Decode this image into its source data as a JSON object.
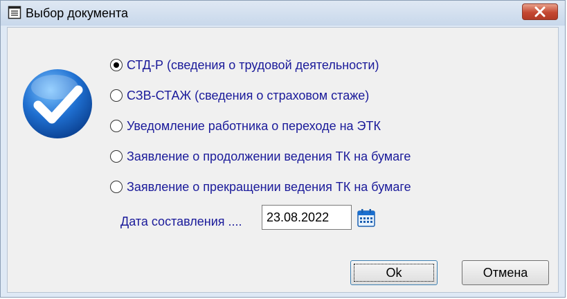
{
  "window": {
    "title": "Выбор документа"
  },
  "options": [
    {
      "label": "СТД-Р (сведения о трудовой деятельности)",
      "checked": true
    },
    {
      "label": "СЗВ-СТАЖ (сведения о страховом стаже)",
      "checked": false
    },
    {
      "label": "Уведомление работника о переходе на ЭТК",
      "checked": false
    },
    {
      "label": "Заявление о продолжении ведения ТК на бумаге",
      "checked": false
    },
    {
      "label": "Заявление о прекращении ведения ТК на бумаге",
      "checked": false
    }
  ],
  "date_field": {
    "label": "Дата составления ....",
    "value": "23.08.2022"
  },
  "buttons": {
    "ok_label": "Ok",
    "cancel_label": "Отмена"
  },
  "icons": {
    "title": "document-icon",
    "close": "close-icon",
    "logo": "checkmark-icon",
    "calendar": "calendar-icon"
  },
  "colors": {
    "label_text": "#1a1a9a",
    "close_button": "#c44832",
    "logo_blue": "#1f6fd0"
  }
}
